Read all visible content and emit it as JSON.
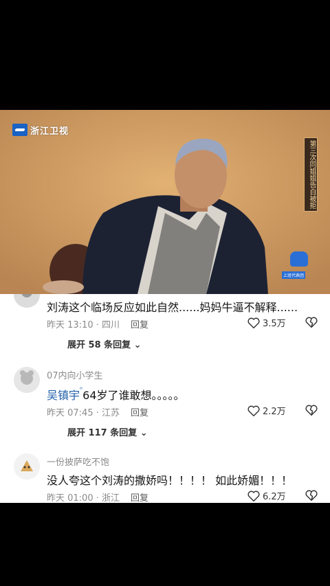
{
  "video": {
    "channel_logo": "浙江卫视",
    "vertical_title": "第三次同姐姐告白被拒",
    "badge": "上班代表团"
  },
  "comments": [
    {
      "username": "",
      "text": "刘涛这个临场反应如此自然......妈妈牛逼不解释......",
      "time": "昨天 13:10",
      "location": "四川",
      "reply_label": "回复",
      "likes": "3.5万",
      "expand": "展开 58 条回复"
    },
    {
      "username": "07内向小学生",
      "mention": "吴镇宇",
      "text": "64岁了谁敢想。。。。。",
      "time": "昨天 07:45",
      "location": "江苏",
      "reply_label": "回复",
      "likes": "2.2万",
      "expand": "展开 117 条回复"
    },
    {
      "username": "一份披萨吃不饱",
      "text": "没人夸这个刘涛的撒娇吗！！！！ 如此娇媚！！！",
      "time": "昨天 01:00",
      "location": "浙江",
      "reply_label": "回复",
      "likes": "6.2万"
    }
  ]
}
